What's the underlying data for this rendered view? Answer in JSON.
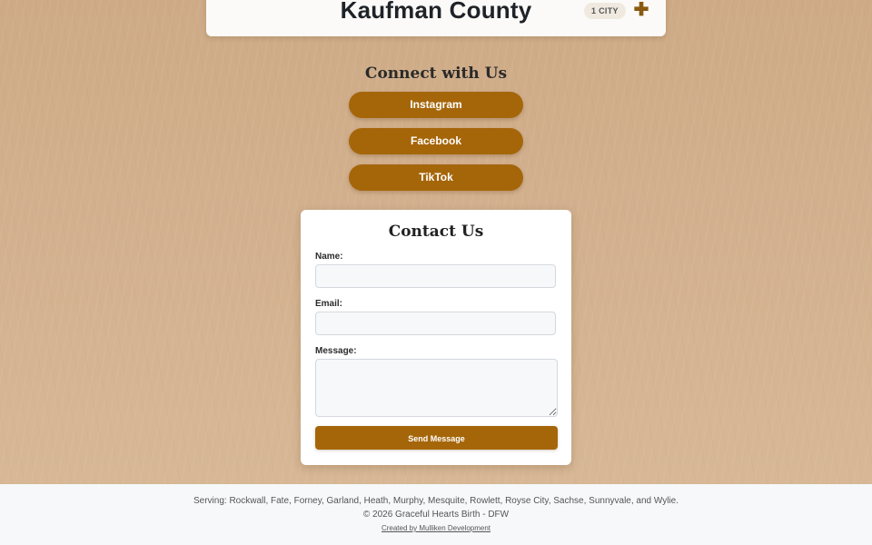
{
  "county_card": {
    "title": "Kaufman County",
    "badge": "1 CITY",
    "toggle_icon": "plus-icon",
    "toggle_symbol": "✚"
  },
  "connect": {
    "heading": "Connect with Us",
    "buttons": [
      {
        "label": "Instagram"
      },
      {
        "label": "Facebook"
      },
      {
        "label": "TikTok"
      }
    ]
  },
  "contact": {
    "title": "Contact Us",
    "name_label": "Name:",
    "name_value": "",
    "email_label": "Email:",
    "email_value": "",
    "message_label": "Message:",
    "message_value": "",
    "send_label": "Send Message"
  },
  "footer": {
    "serving": "Serving: Rockwall, Fate, Forney, Garland, Heath, Murphy, Mesquite, Rowlett, Royse City, Sachse, Sunnyvale, and Wylie.",
    "copyright": "© 2026 Graceful Hearts Birth - DFW",
    "credit": "Created by Mulliken Development"
  },
  "colors": {
    "accent": "#a5660a",
    "toggle": "#8a5a10",
    "background": "#d3b18f",
    "footer_bg": "#f7f8fa"
  }
}
